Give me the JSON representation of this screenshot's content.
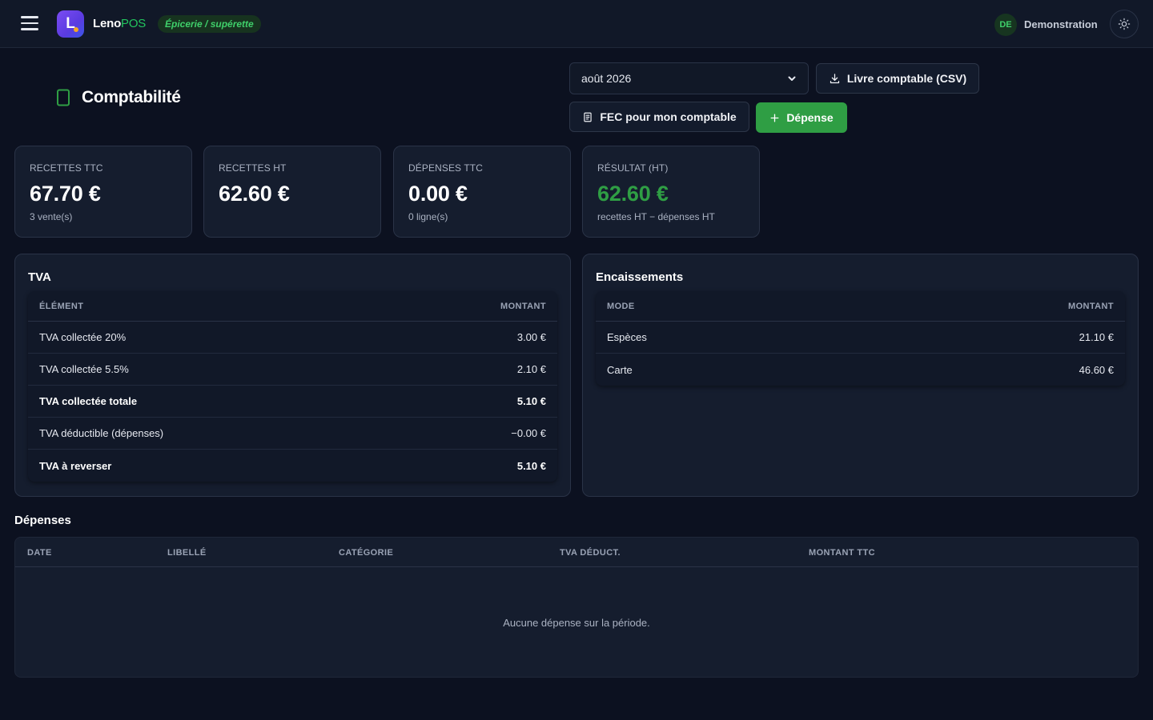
{
  "header": {
    "brand_part1": "Leno",
    "brand_part2": "POS",
    "logo_letter": "L",
    "store_type": "Épicerie / supérette",
    "user_initials": "DE",
    "user_name": "Demonstration",
    "icons": [
      "menu-icon",
      "sun-icon"
    ]
  },
  "page": {
    "title": "Comptabilité",
    "icon": "smartphone-icon"
  },
  "toolbar": {
    "month_value": "août 2026",
    "csv_label": "Livre comptable (CSV)",
    "fec_label": "FEC pour mon comptable",
    "expense_label": "Dépense"
  },
  "kpis": [
    {
      "label": "Recettes TTC",
      "value": "67.70 €",
      "sub": "3 vente(s)"
    },
    {
      "label": "Recettes HT",
      "value": "62.60 €",
      "sub": ""
    },
    {
      "label": "Dépenses TTC",
      "value": "0.00 €",
      "sub": "0 ligne(s)"
    },
    {
      "label": "Résultat (HT)",
      "value": "62.60 €",
      "sub": "recettes HT − dépenses HT"
    }
  ],
  "tva": {
    "title": "TVA",
    "col1": "Élément",
    "col2": "Montant",
    "rows": [
      {
        "label": "TVA collectée 20%",
        "amount": "3.00 €"
      },
      {
        "label": "TVA collectée 5.5%",
        "amount": "2.10 €"
      },
      {
        "label": "TVA collectée totale",
        "amount": "5.10 €"
      },
      {
        "label": "TVA déductible (dépenses)",
        "amount": "−0.00 €"
      },
      {
        "label": "TVA à reverser",
        "amount": "5.10 €"
      }
    ]
  },
  "encaissements": {
    "title": "Encaissements",
    "col1": "Mode",
    "col2": "Montant",
    "rows": [
      {
        "label": "Espèces",
        "amount": "21.10 €"
      },
      {
        "label": "Carte",
        "amount": "46.60 €"
      }
    ]
  },
  "depenses": {
    "title": "Dépenses",
    "columns": [
      "Date",
      "Libellé",
      "Catégorie",
      "TVA déduct.",
      "Montant TTC"
    ],
    "empty_message": "Aucune dépense sur la période."
  },
  "colors": {
    "background": "#0c1120",
    "card": "#151d2e",
    "accent_green": "#2f9e44",
    "brand_purple": "#6a44ee"
  }
}
